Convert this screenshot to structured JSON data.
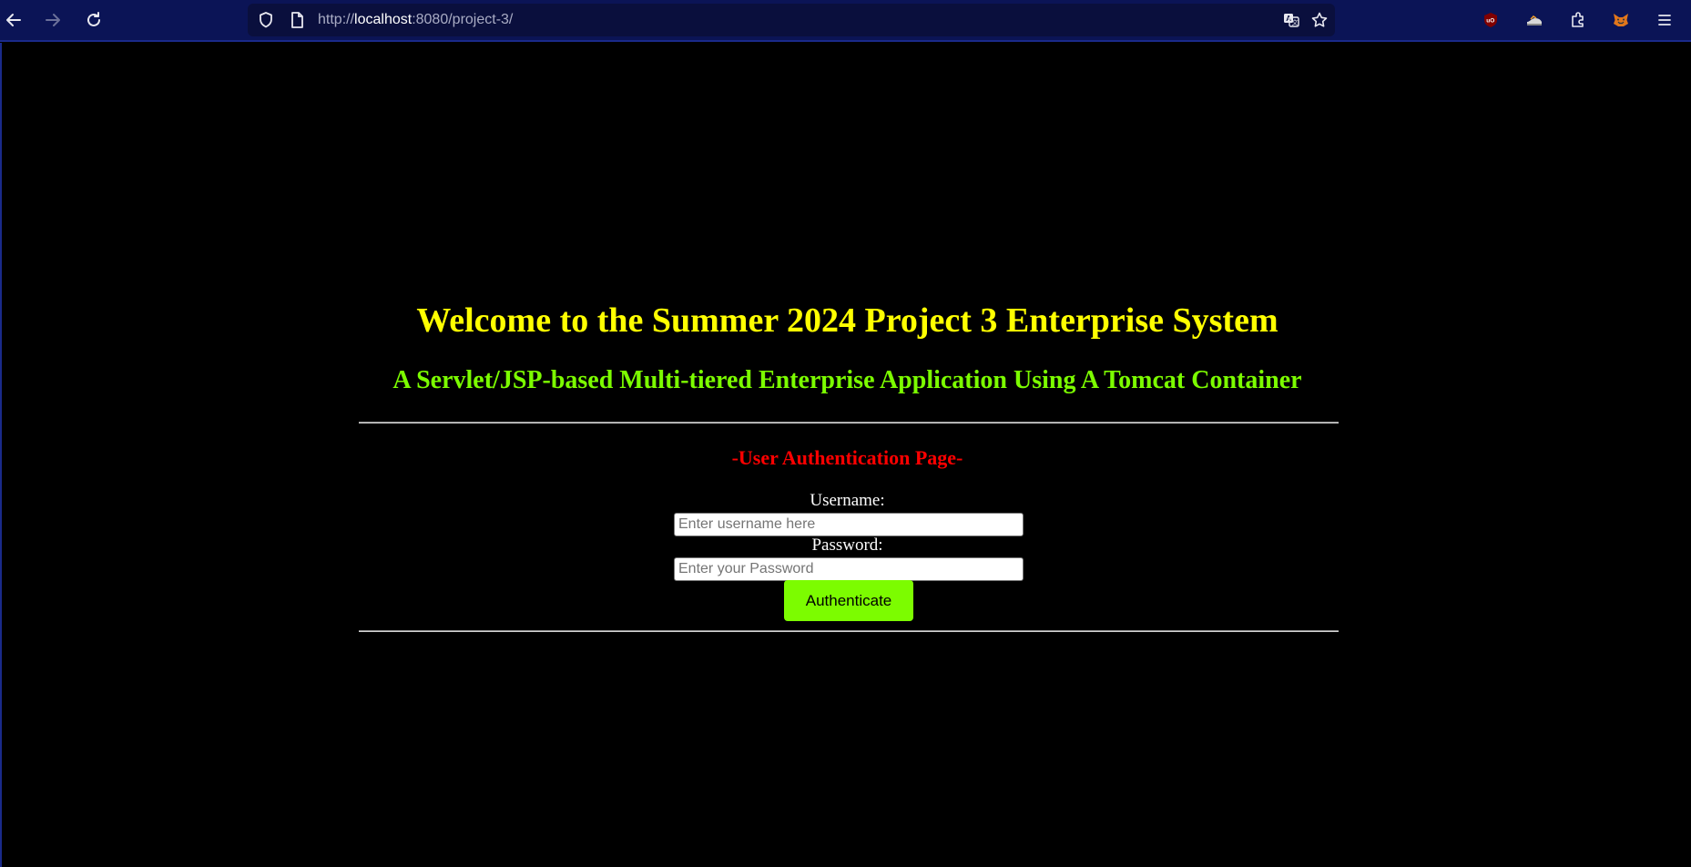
{
  "browser": {
    "url_prefix": "http://",
    "url_host": "localhost",
    "url_rest": ":8080/project-3/",
    "toolbar_color": "#0b1456",
    "icons": [
      "back-arrow-icon",
      "forward-arrow-icon",
      "reload-icon",
      "shield-icon",
      "page-icon",
      "translate-icon",
      "star-icon",
      "ublock-icon",
      "extension-sneakers-icon",
      "puzzle-icon",
      "metamask-fox-icon",
      "hamburger-menu-icon"
    ]
  },
  "page": {
    "title": "Welcome to the Summer 2024 Project 3 Enterprise System",
    "subtitle": "A Servlet/JSP-based Multi-tiered Enterprise Application Using A Tomcat Container",
    "auth_heading": "-User Authentication Page-",
    "username_label": "Username:",
    "username_placeholder": "Enter username here",
    "password_label": "Password:",
    "password_placeholder": "Enter your Password",
    "submit_label": "Authenticate",
    "colors": {
      "background": "#000000",
      "title": "#ffff00",
      "subtitle": "#7cfc00",
      "auth_heading": "#ff0000",
      "button": "#7cfc00"
    }
  }
}
